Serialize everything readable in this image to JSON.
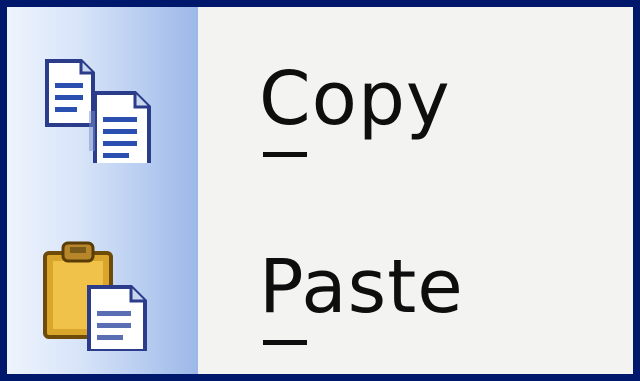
{
  "menu": {
    "items": [
      {
        "label": "Copy",
        "mnemonic": "C",
        "icon": "copy-icon"
      },
      {
        "label": "Paste",
        "mnemonic": "P",
        "icon": "paste-icon"
      }
    ]
  },
  "colors": {
    "border": "#00186b",
    "menu_background": "#f3f3f1",
    "gutter_gradient_start": "#eef4fd",
    "gutter_gradient_end": "#9cb8e8",
    "text": "#0e0e0e"
  }
}
